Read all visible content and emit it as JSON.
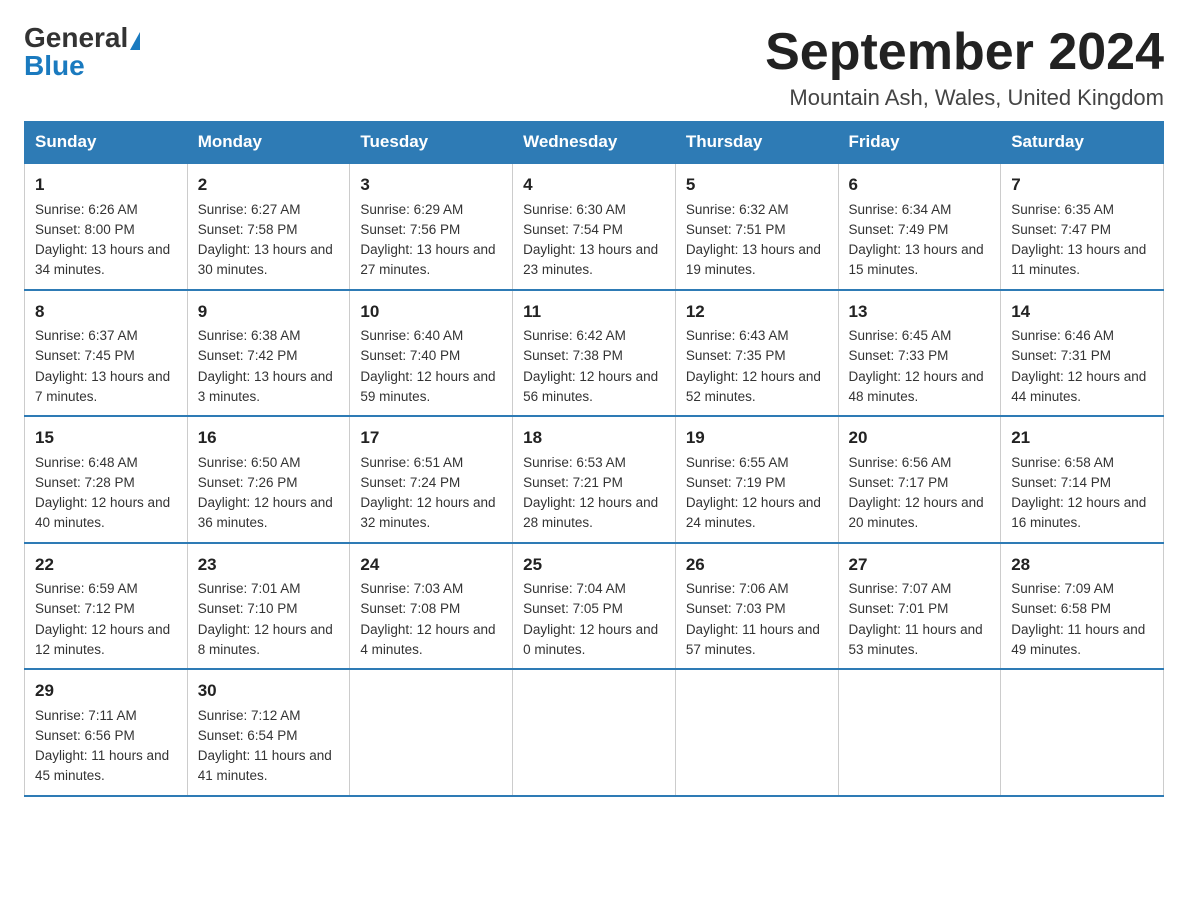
{
  "header": {
    "logo_general": "General",
    "logo_blue": "Blue",
    "month_title": "September 2024",
    "location": "Mountain Ash, Wales, United Kingdom"
  },
  "days_of_week": [
    "Sunday",
    "Monday",
    "Tuesday",
    "Wednesday",
    "Thursday",
    "Friday",
    "Saturday"
  ],
  "weeks": [
    [
      {
        "day": "1",
        "sunrise": "6:26 AM",
        "sunset": "8:00 PM",
        "daylight": "13 hours and 34 minutes."
      },
      {
        "day": "2",
        "sunrise": "6:27 AM",
        "sunset": "7:58 PM",
        "daylight": "13 hours and 30 minutes."
      },
      {
        "day": "3",
        "sunrise": "6:29 AM",
        "sunset": "7:56 PM",
        "daylight": "13 hours and 27 minutes."
      },
      {
        "day": "4",
        "sunrise": "6:30 AM",
        "sunset": "7:54 PM",
        "daylight": "13 hours and 23 minutes."
      },
      {
        "day": "5",
        "sunrise": "6:32 AM",
        "sunset": "7:51 PM",
        "daylight": "13 hours and 19 minutes."
      },
      {
        "day": "6",
        "sunrise": "6:34 AM",
        "sunset": "7:49 PM",
        "daylight": "13 hours and 15 minutes."
      },
      {
        "day": "7",
        "sunrise": "6:35 AM",
        "sunset": "7:47 PM",
        "daylight": "13 hours and 11 minutes."
      }
    ],
    [
      {
        "day": "8",
        "sunrise": "6:37 AM",
        "sunset": "7:45 PM",
        "daylight": "13 hours and 7 minutes."
      },
      {
        "day": "9",
        "sunrise": "6:38 AM",
        "sunset": "7:42 PM",
        "daylight": "13 hours and 3 minutes."
      },
      {
        "day": "10",
        "sunrise": "6:40 AM",
        "sunset": "7:40 PM",
        "daylight": "12 hours and 59 minutes."
      },
      {
        "day": "11",
        "sunrise": "6:42 AM",
        "sunset": "7:38 PM",
        "daylight": "12 hours and 56 minutes."
      },
      {
        "day": "12",
        "sunrise": "6:43 AM",
        "sunset": "7:35 PM",
        "daylight": "12 hours and 52 minutes."
      },
      {
        "day": "13",
        "sunrise": "6:45 AM",
        "sunset": "7:33 PM",
        "daylight": "12 hours and 48 minutes."
      },
      {
        "day": "14",
        "sunrise": "6:46 AM",
        "sunset": "7:31 PM",
        "daylight": "12 hours and 44 minutes."
      }
    ],
    [
      {
        "day": "15",
        "sunrise": "6:48 AM",
        "sunset": "7:28 PM",
        "daylight": "12 hours and 40 minutes."
      },
      {
        "day": "16",
        "sunrise": "6:50 AM",
        "sunset": "7:26 PM",
        "daylight": "12 hours and 36 minutes."
      },
      {
        "day": "17",
        "sunrise": "6:51 AM",
        "sunset": "7:24 PM",
        "daylight": "12 hours and 32 minutes."
      },
      {
        "day": "18",
        "sunrise": "6:53 AM",
        "sunset": "7:21 PM",
        "daylight": "12 hours and 28 minutes."
      },
      {
        "day": "19",
        "sunrise": "6:55 AM",
        "sunset": "7:19 PM",
        "daylight": "12 hours and 24 minutes."
      },
      {
        "day": "20",
        "sunrise": "6:56 AM",
        "sunset": "7:17 PM",
        "daylight": "12 hours and 20 minutes."
      },
      {
        "day": "21",
        "sunrise": "6:58 AM",
        "sunset": "7:14 PM",
        "daylight": "12 hours and 16 minutes."
      }
    ],
    [
      {
        "day": "22",
        "sunrise": "6:59 AM",
        "sunset": "7:12 PM",
        "daylight": "12 hours and 12 minutes."
      },
      {
        "day": "23",
        "sunrise": "7:01 AM",
        "sunset": "7:10 PM",
        "daylight": "12 hours and 8 minutes."
      },
      {
        "day": "24",
        "sunrise": "7:03 AM",
        "sunset": "7:08 PM",
        "daylight": "12 hours and 4 minutes."
      },
      {
        "day": "25",
        "sunrise": "7:04 AM",
        "sunset": "7:05 PM",
        "daylight": "12 hours and 0 minutes."
      },
      {
        "day": "26",
        "sunrise": "7:06 AM",
        "sunset": "7:03 PM",
        "daylight": "11 hours and 57 minutes."
      },
      {
        "day": "27",
        "sunrise": "7:07 AM",
        "sunset": "7:01 PM",
        "daylight": "11 hours and 53 minutes."
      },
      {
        "day": "28",
        "sunrise": "7:09 AM",
        "sunset": "6:58 PM",
        "daylight": "11 hours and 49 minutes."
      }
    ],
    [
      {
        "day": "29",
        "sunrise": "7:11 AM",
        "sunset": "6:56 PM",
        "daylight": "11 hours and 45 minutes."
      },
      {
        "day": "30",
        "sunrise": "7:12 AM",
        "sunset": "6:54 PM",
        "daylight": "11 hours and 41 minutes."
      },
      null,
      null,
      null,
      null,
      null
    ]
  ],
  "labels": {
    "sunrise": "Sunrise:",
    "sunset": "Sunset:",
    "daylight": "Daylight:"
  }
}
